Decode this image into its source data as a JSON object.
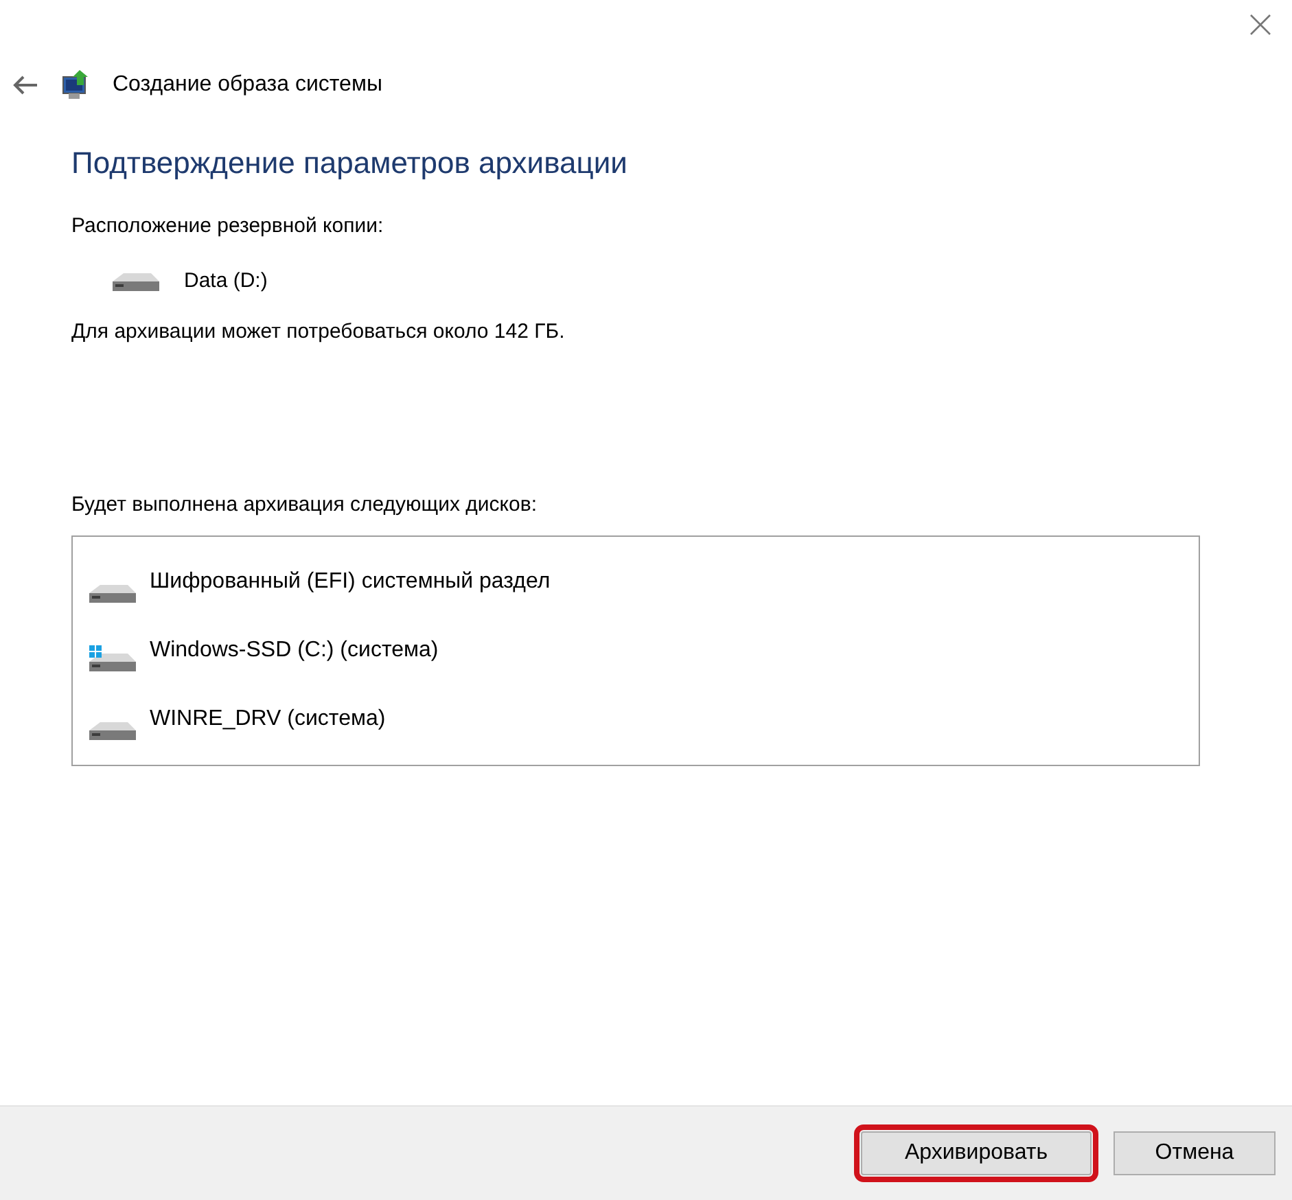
{
  "window": {
    "title": "Создание образа системы"
  },
  "heading": "Подтверждение параметров архивации",
  "location_label": "Расположение резервной копии:",
  "location": {
    "kind": "drive",
    "name": "Data (D:)"
  },
  "space_note": "Для архивации может потребоваться около 142 ГБ.",
  "disks_label": "Будет выполнена архивация следующих дисков:",
  "disks": [
    {
      "kind": "drive",
      "name": "Шифрованный (EFI) системный раздел"
    },
    {
      "kind": "windows",
      "name": "Windows-SSD (C:) (система)"
    },
    {
      "kind": "drive",
      "name": "WINRE_DRV (система)"
    }
  ],
  "buttons": [
    {
      "label": "Архивировать",
      "highlighted": true
    },
    {
      "label": "Отмена",
      "highlighted": false
    }
  ]
}
